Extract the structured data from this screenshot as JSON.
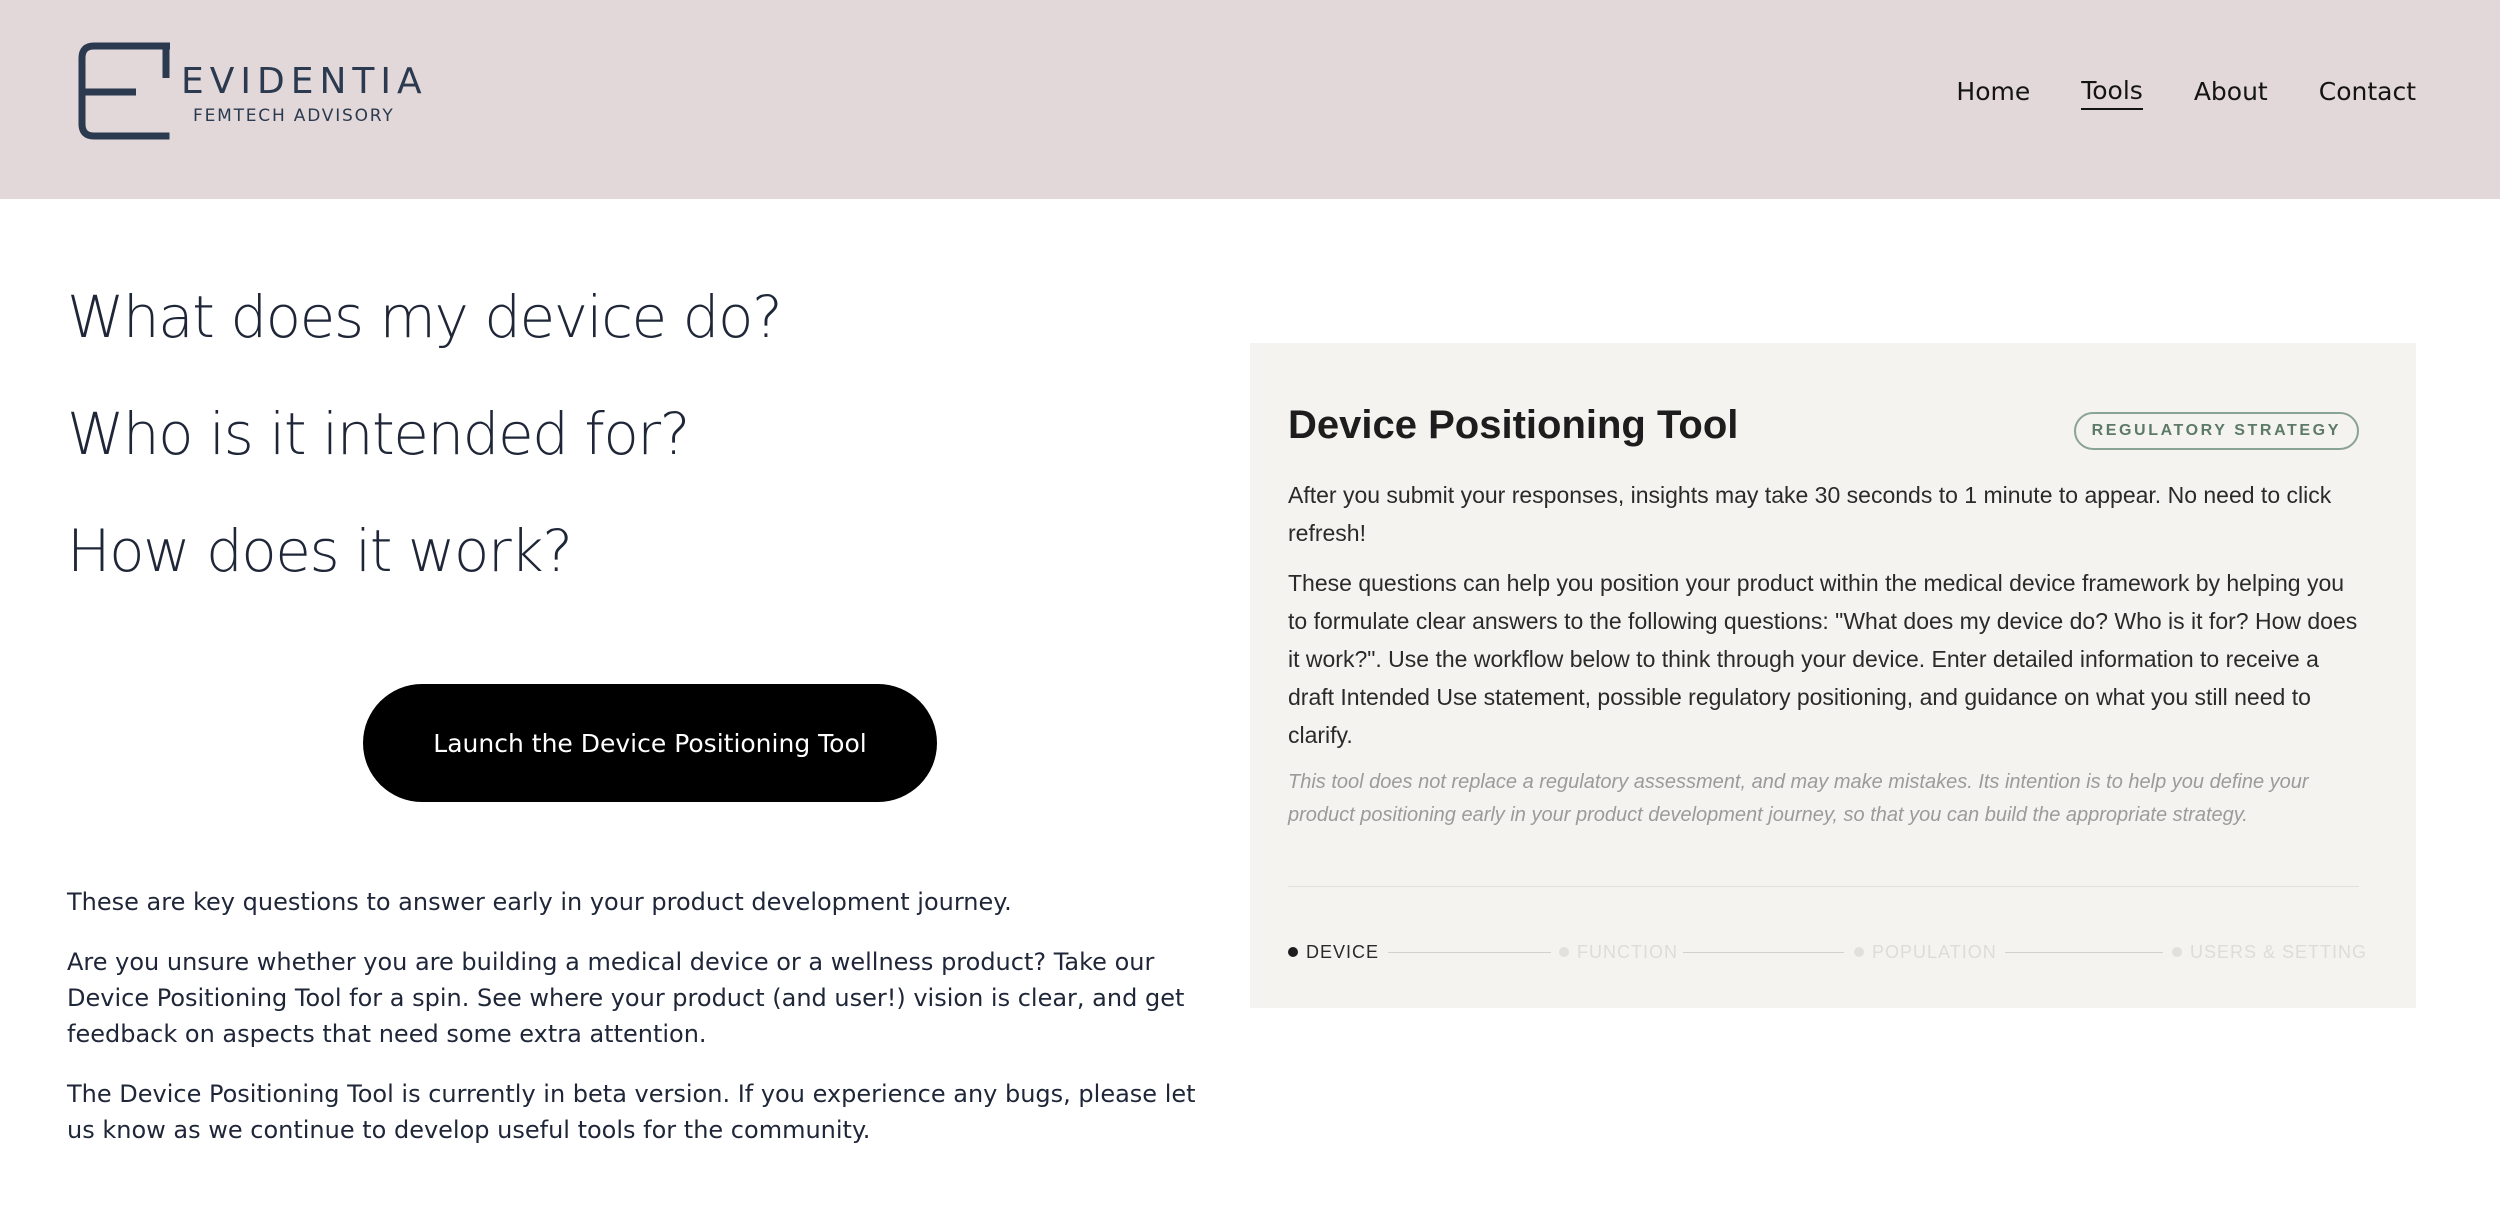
{
  "brand": {
    "name": "EVIDENTIA",
    "tagline": "FEMTECH ADVISORY",
    "color": "#2b3a4f"
  },
  "nav": {
    "items": [
      {
        "label": "Home",
        "active": false
      },
      {
        "label": "Tools",
        "active": true
      },
      {
        "label": "About",
        "active": false
      },
      {
        "label": "Contact",
        "active": false
      }
    ]
  },
  "hero": {
    "questions": [
      "What does my device do?",
      "Who is it intended for?",
      "How does it work?"
    ],
    "cta_label": "Launch the Device Positioning Tool"
  },
  "intro": {
    "paragraphs": [
      "These are key questions to answer early in your product development journey.",
      "Are you unsure whether you are building a medical device or a wellness product?  Take our Device Positioning Tool for a spin.  See where your product (and user!) vision is clear, and get feedback on aspects that need some extra attention.",
      "The Device Positioning Tool is currently in beta version.  If you experience any bugs, please let us know as we continue to develop useful tools for the community."
    ]
  },
  "tool_card": {
    "title": "Device Positioning Tool",
    "badge": "REGULATORY STRATEGY",
    "text_1": "After you submit your responses, insights may take 30 seconds to 1 minute to appear. No need to click refresh!",
    "text_2": "These questions can help you position your product within the medical device framework by helping you to formulate clear answers to the following questions: \"What does my device do? Who is it for? How does it work?\". Use the workflow below to think through your device. Enter detailed information to receive a draft Intended Use statement, possible regulatory positioning, and guidance on what you still need to clarify.",
    "disclaimer": "This tool does not replace a regulatory assessment, and may make mistakes. Its intention is to help you define your product positioning early in your product development journey, so that you can build the appropriate strategy.",
    "steps": [
      {
        "label": "DEVICE",
        "active": true
      },
      {
        "label": "FUNCTION",
        "active": false
      },
      {
        "label": "POPULATION",
        "active": false
      },
      {
        "label": "USERS & SETTING",
        "active": false
      }
    ]
  },
  "colors": {
    "header_bg": "#e2d7d9",
    "card_bg": "#f4f3f0",
    "badge": "#5c7a66",
    "cta_bg": "#000000"
  }
}
